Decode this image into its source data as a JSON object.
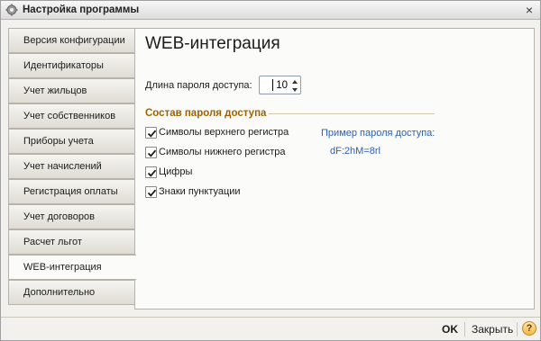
{
  "window": {
    "title": "Настройка программы",
    "close_glyph": "×",
    "icon": "gear-icon"
  },
  "tabs": [
    {
      "label": "Версия конфигурации",
      "active": false
    },
    {
      "label": "Идентификаторы",
      "active": false
    },
    {
      "label": "Учет жильцов",
      "active": false
    },
    {
      "label": "Учет собственников",
      "active": false
    },
    {
      "label": "Приборы учета",
      "active": false
    },
    {
      "label": "Учет начислений",
      "active": false
    },
    {
      "label": "Регистрация оплаты",
      "active": false
    },
    {
      "label": "Учет договоров",
      "active": false
    },
    {
      "label": "Расчет льгот",
      "active": false
    },
    {
      "label": "WEB-интеграция",
      "active": true
    },
    {
      "label": "Дополнительно",
      "active": false
    }
  ],
  "main": {
    "title": "WEB-интеграция",
    "password_length": {
      "label": "Длина пароля доступа:",
      "value": "10"
    },
    "composition": {
      "title": "Состав пароля доступа",
      "options": [
        {
          "label": "Символы верхнего регистра",
          "checked": true
        },
        {
          "label": "Символы нижнего регистра",
          "checked": true
        },
        {
          "label": "Цифры",
          "checked": true
        },
        {
          "label": "Знаки пунктуации",
          "checked": true
        }
      ]
    },
    "example": {
      "label": "Пример пароля доступа:",
      "value": "dF:2hM=8rl"
    }
  },
  "footer": {
    "ok_label": "OK",
    "close_label": "Закрыть",
    "help_label": "?"
  },
  "colors": {
    "accent_group_title": "#a06200",
    "example_text": "#2d5fb5"
  }
}
